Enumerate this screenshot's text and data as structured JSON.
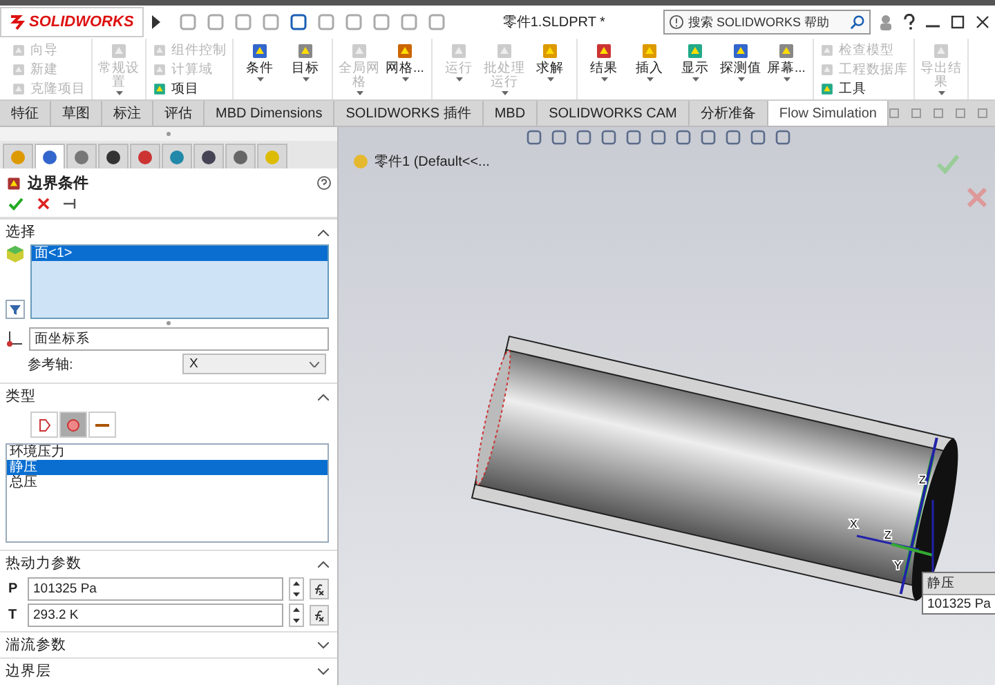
{
  "title_bar": {
    "logo": "SOLIDWORKS",
    "document_title": "零件1.SLDPRT *",
    "search": {
      "placeholder": "搜索 SOLIDWORKS 帮助"
    }
  },
  "ribbon": {
    "groups": [
      {
        "kind": "stack",
        "items": [
          {
            "label": "向导",
            "disabled": true
          },
          {
            "label": "新建",
            "disabled": true
          },
          {
            "label": "克隆项目",
            "disabled": true
          }
        ]
      },
      {
        "kind": "large",
        "items": [
          {
            "label": "常规设置",
            "disabled": true
          }
        ]
      },
      {
        "kind": "stack",
        "items": [
          {
            "label": "组件控制",
            "disabled": true
          },
          {
            "label": "计算域",
            "disabled": true
          },
          {
            "label": "项目",
            "disabled": false
          }
        ]
      },
      {
        "kind": "large",
        "items": [
          {
            "label": "条件",
            "disabled": false
          },
          {
            "label": "目标",
            "disabled": false
          }
        ]
      },
      {
        "kind": "large",
        "items": [
          {
            "label": "全局网格",
            "disabled": true
          },
          {
            "label": "网格...",
            "disabled": false
          }
        ]
      },
      {
        "kind": "large",
        "items": [
          {
            "label": "运行",
            "disabled": true
          },
          {
            "label": "批处理运行",
            "disabled": true
          },
          {
            "label": "求解",
            "disabled": false
          }
        ]
      },
      {
        "kind": "large",
        "items": [
          {
            "label": "结果",
            "disabled": false
          },
          {
            "label": "插入",
            "disabled": false
          },
          {
            "label": "显示",
            "disabled": false
          },
          {
            "label": "探测值",
            "disabled": false
          },
          {
            "label": "屏幕...",
            "disabled": false
          }
        ]
      },
      {
        "kind": "stack",
        "items": [
          {
            "label": "检查模型",
            "disabled": true
          },
          {
            "label": "工程数据库",
            "disabled": true
          },
          {
            "label": "工具",
            "disabled": false
          }
        ]
      },
      {
        "kind": "large",
        "items": [
          {
            "label": "导出结果",
            "disabled": true
          }
        ]
      }
    ]
  },
  "command_tabs": [
    {
      "label": "特征",
      "selected": false
    },
    {
      "label": "草图",
      "selected": false
    },
    {
      "label": "标注",
      "selected": false
    },
    {
      "label": "评估",
      "selected": false
    },
    {
      "label": "MBD Dimensions",
      "selected": false
    },
    {
      "label": "SOLIDWORKS 插件",
      "selected": false
    },
    {
      "label": "MBD",
      "selected": false
    },
    {
      "label": "SOLIDWORKS CAM",
      "selected": false
    },
    {
      "label": "分析准备",
      "selected": false
    },
    {
      "label": "Flow Simulation",
      "selected": true
    }
  ],
  "panel": {
    "tabs": [
      {
        "selected": false
      },
      {
        "selected": true
      },
      {
        "selected": false
      },
      {
        "selected": false
      },
      {
        "selected": false
      },
      {
        "selected": false
      },
      {
        "selected": false
      },
      {
        "selected": false
      },
      {
        "selected": false
      }
    ],
    "title": "边界条件",
    "selection": {
      "header": "选择",
      "expanded": true,
      "items": [
        {
          "label": "面<1>",
          "selected": true
        }
      ],
      "coordinate_system": "面坐标系",
      "reference_axis_label": "参考轴:",
      "reference_axis": "X"
    },
    "type": {
      "header": "类型",
      "expanded": true,
      "type_buttons": [
        {
          "selected": false
        },
        {
          "selected": true
        },
        {
          "selected": false
        }
      ],
      "items": [
        {
          "label": "环境压力",
          "selected": false
        },
        {
          "label": "静压",
          "selected": true
        },
        {
          "label": "总压",
          "selected": false
        }
      ]
    },
    "thermo": {
      "header": "热动力参数",
      "expanded": true,
      "fields": [
        {
          "label": "P",
          "value": "101325 Pa"
        },
        {
          "label": "T",
          "value": "293.2 K"
        }
      ]
    },
    "collapsed_sections": [
      {
        "header": "湍流参数",
        "expanded": false
      },
      {
        "header": "边界层",
        "expanded": false
      }
    ]
  },
  "viewport": {
    "tree_label": "零件1  (Default<<...",
    "triad_labels": [
      "Z",
      "X",
      "Z",
      "Y"
    ],
    "callout": {
      "title": "静压",
      "value": "101325 Pa"
    }
  }
}
